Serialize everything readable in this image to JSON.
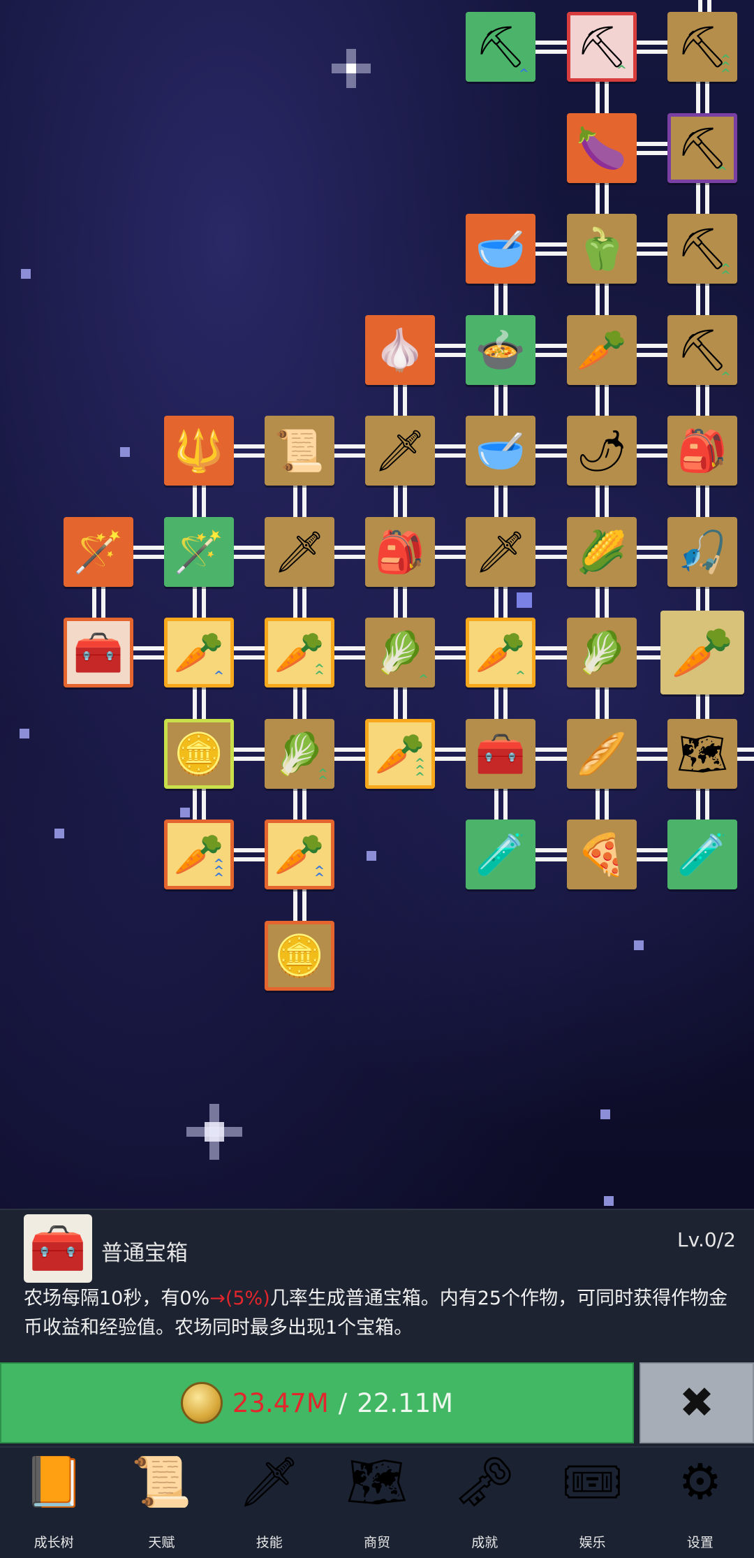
{
  "colors": {
    "orange": "#e4652d",
    "green": "#4cb46a",
    "gold": "#b58e4b",
    "red_tile": "#d93e3e",
    "purple_tile": "#7a3fa3",
    "yellow_frame": "#f8a81c",
    "selected_tile": "#d8c27a",
    "pale_tile": "#f3d9c7",
    "link": "#f4f4f4",
    "button_green": "#42b764",
    "cost_red": "#e3262c"
  },
  "skill_tree": {
    "nodes": [
      {
        "icon": "shovel",
        "glyph": "⛏",
        "bg": "#4cb46a",
        "col": 4,
        "row": 0,
        "up": "^",
        "upc": "#3a78d9"
      },
      {
        "icon": "shovel",
        "glyph": "⛏",
        "bg": "#f3d2d2",
        "border": "#d93e3e",
        "col": 5,
        "row": 0,
        "up": "^",
        "upc": "#4cb46a"
      },
      {
        "icon": "shovel",
        "glyph": "⛏",
        "bg": "#b58e4b",
        "col": 6,
        "row": 0,
        "up": "^^^",
        "upc": "#4cb46a"
      },
      {
        "icon": "eggplant",
        "glyph": "🍆",
        "bg": "#e4652d",
        "col": 5,
        "row": 1
      },
      {
        "icon": "shovel",
        "glyph": "⛏",
        "bg": "#b58e4b",
        "border": "#7a3fa3",
        "col": 6,
        "row": 1,
        "up": "^",
        "upc": "#4cb46a"
      },
      {
        "icon": "bowl",
        "glyph": "🥣",
        "bg": "#e4652d",
        "col": 4,
        "row": 2
      },
      {
        "icon": "pepper",
        "glyph": "🫑",
        "bg": "#b58e4b",
        "col": 5,
        "row": 2
      },
      {
        "icon": "shovel",
        "glyph": "⛏",
        "bg": "#b58e4b",
        "col": 6,
        "row": 2,
        "up": "^^",
        "upc": "#4cb46a"
      },
      {
        "icon": "garlic",
        "glyph": "🧄",
        "bg": "#e4652d",
        "col": 3,
        "row": 3
      },
      {
        "icon": "bowl",
        "glyph": "🍲",
        "bg": "#4cb46a",
        "col": 4,
        "row": 3
      },
      {
        "icon": "radish",
        "glyph": "🥕",
        "bg": "#b58e4b",
        "col": 5,
        "row": 3
      },
      {
        "icon": "shovel",
        "glyph": "⛏",
        "bg": "#b58e4b",
        "col": 6,
        "row": 3,
        "up": "^",
        "upc": "#4cb46a"
      },
      {
        "icon": "staff",
        "glyph": "🔱",
        "bg": "#e4652d",
        "col": 1,
        "row": 4
      },
      {
        "icon": "map",
        "glyph": "📜",
        "bg": "#b58e4b",
        "col": 2,
        "row": 4
      },
      {
        "icon": "sword",
        "glyph": "🗡",
        "bg": "#b58e4b",
        "col": 3,
        "row": 4
      },
      {
        "icon": "bowl",
        "glyph": "🥣",
        "bg": "#b58e4b",
        "col": 4,
        "row": 4
      },
      {
        "icon": "chili",
        "glyph": "🌶",
        "bg": "#b58e4b",
        "col": 5,
        "row": 4
      },
      {
        "icon": "bag",
        "glyph": "🎒",
        "bg": "#b58e4b",
        "col": 6,
        "row": 4
      },
      {
        "icon": "staff",
        "glyph": "🪄",
        "bg": "#e4652d",
        "col": 0,
        "row": 5
      },
      {
        "icon": "staff",
        "glyph": "🪄",
        "bg": "#4cb46a",
        "col": 1,
        "row": 5
      },
      {
        "icon": "sword",
        "glyph": "🗡",
        "bg": "#b58e4b",
        "col": 2,
        "row": 5
      },
      {
        "icon": "bag",
        "glyph": "🎒",
        "bg": "#b58e4b",
        "col": 3,
        "row": 5
      },
      {
        "icon": "sword",
        "glyph": "🗡",
        "bg": "#b58e4b",
        "col": 4,
        "row": 5
      },
      {
        "icon": "corn",
        "glyph": "🌽",
        "bg": "#b58e4b",
        "col": 5,
        "row": 5
      },
      {
        "icon": "rod",
        "glyph": "🎣",
        "bg": "#b58e4b",
        "col": 6,
        "row": 5
      },
      {
        "icon": "chest",
        "glyph": "🧰",
        "bg": "#f3d9c7",
        "border": "#e4652d",
        "col": 0,
        "row": 6
      },
      {
        "icon": "carrot",
        "glyph": "🥕",
        "bg": "#f8d77a",
        "border": "#f8a81c",
        "col": 1,
        "row": 6,
        "up": "^",
        "upc": "#3a78d9"
      },
      {
        "icon": "carrot",
        "glyph": "🥕",
        "bg": "#f8d77a",
        "border": "#f8a81c",
        "col": 2,
        "row": 6,
        "up": "^^",
        "upc": "#4cb46a"
      },
      {
        "icon": "cabbage",
        "glyph": "🥬",
        "bg": "#b58e4b",
        "col": 3,
        "row": 6,
        "up": "^",
        "upc": "#4cb46a"
      },
      {
        "icon": "carrot",
        "glyph": "🥕",
        "bg": "#f8d77a",
        "border": "#f8a81c",
        "col": 4,
        "row": 6,
        "up": "^",
        "upc": "#4cb46a"
      },
      {
        "icon": "cabbage",
        "glyph": "🥬",
        "bg": "#b58e4b",
        "col": 5,
        "row": 6
      },
      {
        "icon": "carrot",
        "glyph": "🥕",
        "bg": "#d8c27a",
        "col": 6,
        "row": 6,
        "selected": true
      },
      {
        "icon": "coin",
        "glyph": "🪙",
        "bg": "#b58e4b",
        "border": "#c9e04a",
        "col": 1,
        "row": 7
      },
      {
        "icon": "cabbage",
        "glyph": "🥬",
        "bg": "#b58e4b",
        "col": 2,
        "row": 7,
        "up": "^^",
        "upc": "#4cb46a"
      },
      {
        "icon": "carrot",
        "glyph": "🥕",
        "bg": "#f8d77a",
        "border": "#f8a81c",
        "col": 3,
        "row": 7,
        "up": "^^^",
        "upc": "#4cb46a"
      },
      {
        "icon": "chest",
        "glyph": "🧰",
        "bg": "#b58e4b",
        "col": 4,
        "row": 7
      },
      {
        "icon": "parsnip",
        "glyph": "🥖",
        "bg": "#b58e4b",
        "col": 5,
        "row": 7
      },
      {
        "icon": "map",
        "glyph": "🗺",
        "bg": "#b58e4b",
        "col": 6,
        "row": 7
      },
      {
        "icon": "carrot",
        "glyph": "🥕",
        "bg": "#f8d77a",
        "border": "#e4652d",
        "col": 1,
        "row": 8,
        "up": "^^^",
        "upc": "#3a78d9"
      },
      {
        "icon": "carrot",
        "glyph": "🥕",
        "bg": "#f8d77a",
        "border": "#e4652d",
        "col": 2,
        "row": 8,
        "up": "^^",
        "upc": "#3a78d9"
      },
      {
        "icon": "potion",
        "glyph": "🧪",
        "bg": "#4cb46a",
        "col": 4,
        "row": 8
      },
      {
        "icon": "pizza",
        "glyph": "🍕",
        "bg": "#b58e4b",
        "col": 5,
        "row": 8
      },
      {
        "icon": "potion",
        "glyph": "🧪",
        "bg": "#4cb46a",
        "col": 6,
        "row": 8
      },
      {
        "icon": "coin",
        "glyph": "🪙",
        "bg": "#b58e4b",
        "border": "#e4652d",
        "col": 2,
        "row": 9
      }
    ]
  },
  "detail": {
    "icon": "chest",
    "icon_glyph": "🧰",
    "title": "普通宝箱",
    "level": "Lv.0/2",
    "desc_before": "农场每隔10秒，有0%",
    "desc_arrow": "→(5%)",
    "desc_after": "几率生成普通宝箱。内有25个作物，可同时获得作物金币收益和经验值。农场同时最多出现1个宝箱。"
  },
  "purchase": {
    "coin_icon": "coin",
    "cost": "23.47M",
    "separator": "/",
    "balance": "22.11M",
    "close_label": "✖"
  },
  "nav": [
    {
      "label": "成长树",
      "icon": "book",
      "glyph": "📙"
    },
    {
      "label": "天赋",
      "icon": "scroll",
      "glyph": "📜"
    },
    {
      "label": "技能",
      "icon": "sword",
      "glyph": "🗡"
    },
    {
      "label": "商贸",
      "icon": "map",
      "glyph": "🗺"
    },
    {
      "label": "成就",
      "icon": "key",
      "glyph": "🗝"
    },
    {
      "label": "娱乐",
      "icon": "ticket",
      "glyph": "🎟"
    },
    {
      "label": "设置",
      "icon": "gear",
      "glyph": "⚙"
    }
  ]
}
